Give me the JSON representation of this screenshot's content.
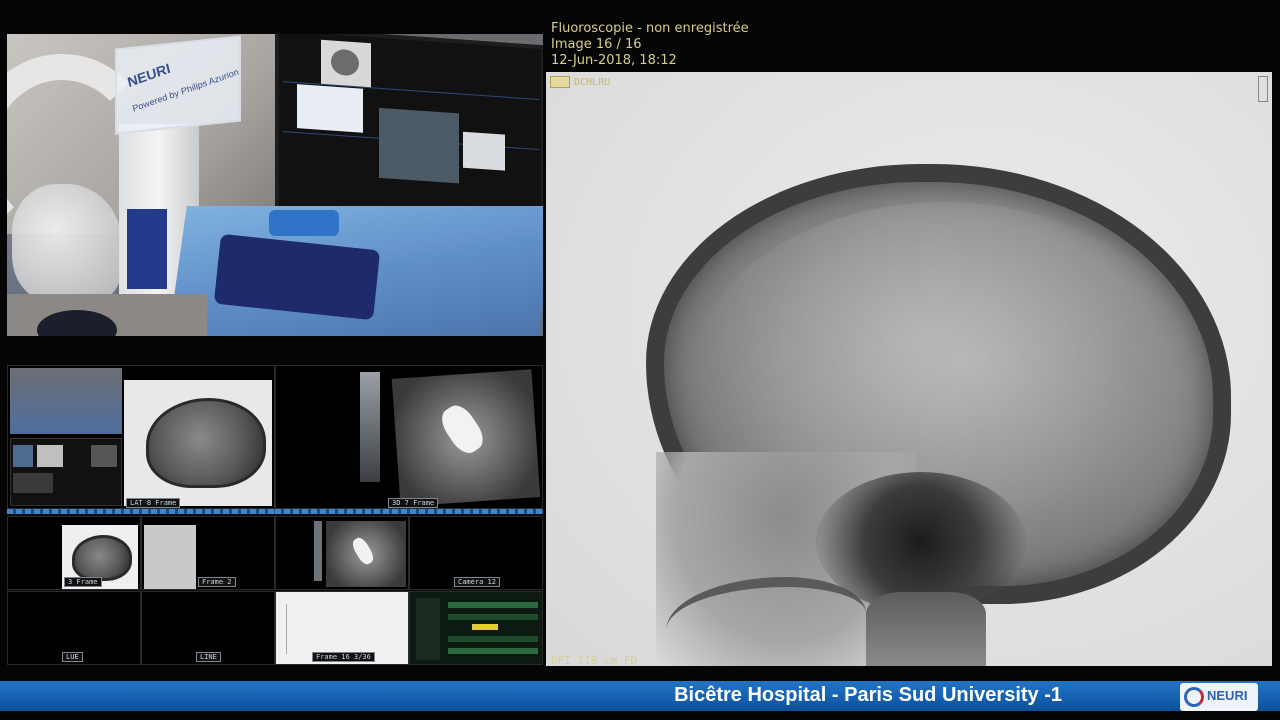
{
  "fluoroscopy": {
    "header_line1": "Fluoroscopie - non enregistrée",
    "header_line2": "Image 16 / 16",
    "header_line3": "12-Jun-2018, 18:12",
    "tag": "DCHLRU",
    "footer": "DFI    119 cm   FD"
  },
  "camera": {
    "sign_title": "NEURI",
    "sign_subtitle": "Powered by Philips Azurion"
  },
  "grid": {
    "labels": [
      "LAT 8 Frame",
      "3D 7 Frame",
      "3 Frame",
      "Frame 2",
      "Camera 12",
      "LUE",
      "LINE",
      "Frame 16 3/36"
    ]
  },
  "banner": {
    "title": "Bicêtre Hospital - Paris Sud University -1",
    "logo_text": "NEURI"
  },
  "colors": {
    "overlay_text": "#d8cf8c",
    "banner_blue": "#1561b0",
    "logo_blue": "#2a63b8",
    "logo_red": "#c42c2c"
  }
}
